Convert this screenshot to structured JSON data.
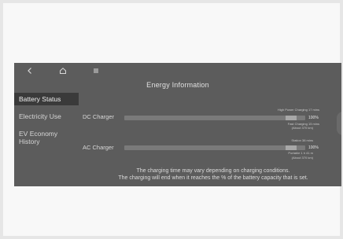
{
  "header": {
    "title": "Energy Information",
    "icons": [
      "back-icon",
      "home-icon",
      "menu-icon"
    ]
  },
  "sidebar": {
    "items": [
      {
        "label": "Battery Status",
        "active": true
      },
      {
        "label": "Electricity Use",
        "active": false
      },
      {
        "label": "EV Economy History",
        "active": false
      }
    ]
  },
  "chargers": {
    "dc": {
      "label": "DC Charger",
      "note_top": "High Power Charging 17 mins",
      "note_mid": "Fast Charging 15 mins",
      "note_bottom": "(About 370 km)",
      "percent_label": "100%",
      "marker_level": 0.95
    },
    "ac": {
      "label": "AC Charger",
      "note_top": "Station 38 mins",
      "note_mid": "Portable 1 h 41 m",
      "note_bottom": "(About 370 km)",
      "percent_label": "100%",
      "marker_level": 0.95
    }
  },
  "footer": {
    "line1": "The charging time may vary depending on charging conditions.",
    "line2": "The charging will end when it reaches the % of the battery capacity that is set."
  },
  "colors": {
    "screen_bg": "#5c5c5c",
    "active_item_bg": "#3a3a3a"
  }
}
